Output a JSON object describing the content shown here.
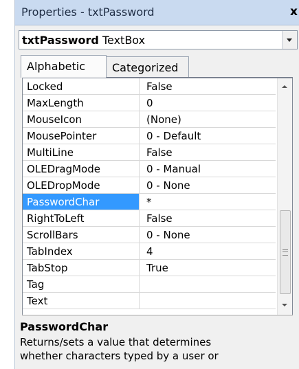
{
  "window": {
    "title": "Properties - txtPassword",
    "close_glyph": "x"
  },
  "object_selector": {
    "object_name": "txtPassword",
    "object_type": "TextBox"
  },
  "tabs": [
    {
      "label": "Alphabetic",
      "active": true
    },
    {
      "label": "Categorized",
      "active": false
    }
  ],
  "properties": [
    {
      "name": "Locked",
      "value": "False"
    },
    {
      "name": "MaxLength",
      "value": "0"
    },
    {
      "name": "MouseIcon",
      "value": "(None)"
    },
    {
      "name": "MousePointer",
      "value": "0 - Default"
    },
    {
      "name": "MultiLine",
      "value": "False"
    },
    {
      "name": "OLEDragMode",
      "value": "0 - Manual"
    },
    {
      "name": "OLEDropMode",
      "value": "0 - None"
    },
    {
      "name": "PasswordChar",
      "value": "*",
      "selected": true
    },
    {
      "name": "RightToLeft",
      "value": "False"
    },
    {
      "name": "ScrollBars",
      "value": "0 - None"
    },
    {
      "name": "TabIndex",
      "value": "4"
    },
    {
      "name": "TabStop",
      "value": "True"
    },
    {
      "name": "Tag",
      "value": ""
    },
    {
      "name": "Text",
      "value": ""
    }
  ],
  "description": {
    "title": "PasswordChar",
    "line1": "Returns/sets a value that determines",
    "line2": "whether characters typed by a user or"
  },
  "colors": {
    "selection": "#3399ff",
    "titlebar": "#c9daf0"
  }
}
